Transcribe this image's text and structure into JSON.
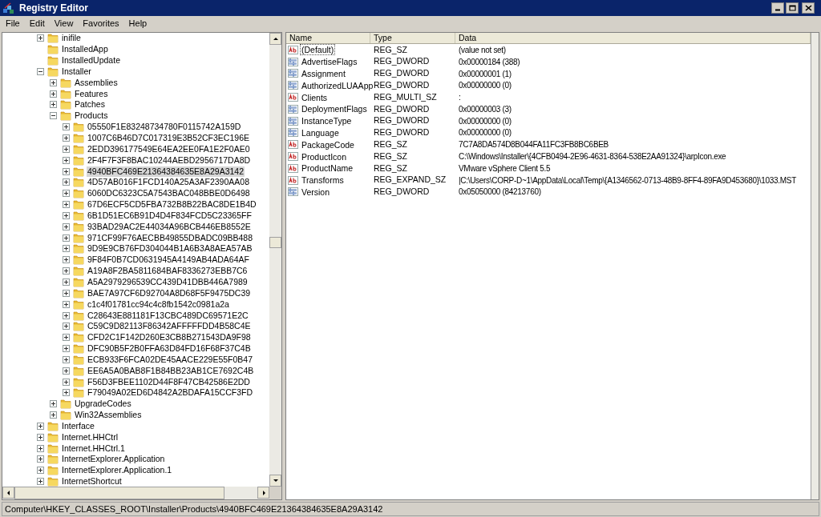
{
  "window": {
    "title": "Registry Editor"
  },
  "menu": [
    "File",
    "Edit",
    "View",
    "Favorites",
    "Help"
  ],
  "tree": [
    {
      "label": "inifile",
      "expandable": true,
      "expanded": false,
      "selected": false
    },
    {
      "label": "InstalledApp",
      "expandable": false,
      "selected": false
    },
    {
      "label": "InstalledUpdate",
      "expandable": false,
      "selected": false
    },
    {
      "label": "Installer",
      "expandable": true,
      "expanded": true,
      "selected": false,
      "children": [
        {
          "label": "Assemblies",
          "expandable": true,
          "expanded": false,
          "selected": false
        },
        {
          "label": "Features",
          "expandable": true,
          "expanded": false,
          "selected": false
        },
        {
          "label": "Patches",
          "expandable": true,
          "expanded": false,
          "selected": false
        },
        {
          "label": "Products",
          "expandable": true,
          "expanded": true,
          "selected": false,
          "children": [
            {
              "label": "05550F1E83248734780F0115742A159D",
              "expandable": true,
              "expanded": false,
              "selected": false
            },
            {
              "label": "1007C6B46D7C017319E3B52CF3EC196E",
              "expandable": true,
              "expanded": false,
              "selected": false
            },
            {
              "label": "2EDD396177549E64EA2EE0FA1E2F0AE0",
              "expandable": true,
              "expanded": false,
              "selected": false
            },
            {
              "label": "2F4F7F3F8BAC10244AEBD2956717DA8D",
              "expandable": true,
              "expanded": false,
              "selected": false
            },
            {
              "label": "4940BFC469E21364384635E8A29A3142",
              "expandable": true,
              "expanded": false,
              "selected": true
            },
            {
              "label": "4D57AB016F1FCD140A25A3AF2390AA08",
              "expandable": true,
              "expanded": false,
              "selected": false
            },
            {
              "label": "6060DC6323C5A7543BAC048BBE0D6498",
              "expandable": true,
              "expanded": false,
              "selected": false
            },
            {
              "label": "67D6ECF5CD5FBA732B8B22BAC8DE1B4D",
              "expandable": true,
              "expanded": false,
              "selected": false
            },
            {
              "label": "6B1D51EC6B91D4D4F834FCD5C23365FF",
              "expandable": true,
              "expanded": false,
              "selected": false
            },
            {
              "label": "93BAD29AC2E44034A96BCB446EB8552E",
              "expandable": true,
              "expanded": false,
              "selected": false
            },
            {
              "label": "971CF99F76AECBB49855DBADC09BB488",
              "expandable": true,
              "expanded": false,
              "selected": false
            },
            {
              "label": "9D9E9CB76FD304044B1A6B3A8AEA57AB",
              "expandable": true,
              "expanded": false,
              "selected": false
            },
            {
              "label": "9F84F0B7CD0631945A4149AB4ADA64AF",
              "expandable": true,
              "expanded": false,
              "selected": false
            },
            {
              "label": "A19A8F2BA5811684BAF8336273EBB7C6",
              "expandable": true,
              "expanded": false,
              "selected": false
            },
            {
              "label": "A5A2979296539CC439D41DBB446A7989",
              "expandable": true,
              "expanded": false,
              "selected": false
            },
            {
              "label": "BAE7A97CF6D92704A8D68F5F9475DC39",
              "expandable": true,
              "expanded": false,
              "selected": false
            },
            {
              "label": "c1c4f01781cc94c4c8fb1542c0981a2a",
              "expandable": true,
              "expanded": false,
              "selected": false
            },
            {
              "label": "C28643E881181F13CBC489DC69571E2C",
              "expandable": true,
              "expanded": false,
              "selected": false
            },
            {
              "label": "C59C9D82113F86342AFFFFFDD4B58C4E",
              "expandable": true,
              "expanded": false,
              "selected": false
            },
            {
              "label": "CFD2C1F142D260E3CB8B271543DA9F98",
              "expandable": true,
              "expanded": false,
              "selected": false
            },
            {
              "label": "DFC90B5F2B0FFA63D84FD16F68F37C4B",
              "expandable": true,
              "expanded": false,
              "selected": false
            },
            {
              "label": "ECB933F6FCA02DE45AACE229E55F0B47",
              "expandable": true,
              "expanded": false,
              "selected": false
            },
            {
              "label": "EE6A5A0BAB8F1B84BB23AB1CE7692C4B",
              "expandable": true,
              "expanded": false,
              "selected": false
            },
            {
              "label": "F56D3FBEE1102D44F8F47CB42586E2DD",
              "expandable": true,
              "expanded": false,
              "selected": false
            },
            {
              "label": "F79049A02ED6D4842A2BDAFA15CCF3FD",
              "expandable": true,
              "expanded": false,
              "selected": false
            }
          ]
        },
        {
          "label": "UpgradeCodes",
          "expandable": true,
          "expanded": false,
          "selected": false
        },
        {
          "label": "Win32Assemblies",
          "expandable": true,
          "expanded": false,
          "selected": false
        }
      ]
    },
    {
      "label": "Interface",
      "expandable": true,
      "expanded": false,
      "selected": false
    },
    {
      "label": "Internet.HHCtrl",
      "expandable": true,
      "expanded": false,
      "selected": false
    },
    {
      "label": "Internet.HHCtrl.1",
      "expandable": true,
      "expanded": false,
      "selected": false
    },
    {
      "label": "InternetExplorer.Application",
      "expandable": true,
      "expanded": false,
      "selected": false
    },
    {
      "label": "InternetExplorer.Application.1",
      "expandable": true,
      "expanded": false,
      "selected": false
    },
    {
      "label": "InternetShortcut",
      "expandable": true,
      "expanded": false,
      "selected": false
    }
  ],
  "values": {
    "columns": [
      "Name",
      "Type",
      "Data"
    ],
    "rows": [
      {
        "kind": "string",
        "name": "(Default)",
        "type": "REG_SZ",
        "data": "(value not set)",
        "focused": true
      },
      {
        "kind": "binary",
        "name": "AdvertiseFlags",
        "type": "REG_DWORD",
        "data": "0x00000184 (388)",
        "focused": false
      },
      {
        "kind": "binary",
        "name": "Assignment",
        "type": "REG_DWORD",
        "data": "0x00000001 (1)",
        "focused": false
      },
      {
        "kind": "binary",
        "name": "AuthorizedLUAApp",
        "type": "REG_DWORD",
        "data": "0x00000000 (0)",
        "focused": false
      },
      {
        "kind": "string",
        "name": "Clients",
        "type": "REG_MULTI_SZ",
        "data": ":",
        "focused": false
      },
      {
        "kind": "binary",
        "name": "DeploymentFlags",
        "type": "REG_DWORD",
        "data": "0x00000003 (3)",
        "focused": false
      },
      {
        "kind": "binary",
        "name": "InstanceType",
        "type": "REG_DWORD",
        "data": "0x00000000 (0)",
        "focused": false
      },
      {
        "kind": "binary",
        "name": "Language",
        "type": "REG_DWORD",
        "data": "0x00000000 (0)",
        "focused": false
      },
      {
        "kind": "string",
        "name": "PackageCode",
        "type": "REG_SZ",
        "data": "7C7A8DA574D8B044FA11FC3FB8BC6BEB",
        "focused": false
      },
      {
        "kind": "string",
        "name": "ProductIcon",
        "type": "REG_SZ",
        "data": "C:\\Windows\\Installer\\{4CFB0494-2E96-4631-8364-538E2AA91324}\\arpIcon.exe",
        "focused": false
      },
      {
        "kind": "string",
        "name": "ProductName",
        "type": "REG_SZ",
        "data": "VMware vSphere Client 5.5",
        "focused": false
      },
      {
        "kind": "string",
        "name": "Transforms",
        "type": "REG_EXPAND_SZ",
        "data": "|C:\\Users\\CORP-D~1\\AppData\\Local\\Temp\\{A1346562-0713-48B9-8FF4-89FA9D453680}\\1033.MST",
        "focused": false
      },
      {
        "kind": "binary",
        "name": "Version",
        "type": "REG_DWORD",
        "data": "0x05050000 (84213760)",
        "focused": false
      }
    ]
  },
  "status_bar": "Computer\\HKEY_CLASSES_ROOT\\Installer\\Products\\4940BFC469E21364384635E8A29A3142"
}
